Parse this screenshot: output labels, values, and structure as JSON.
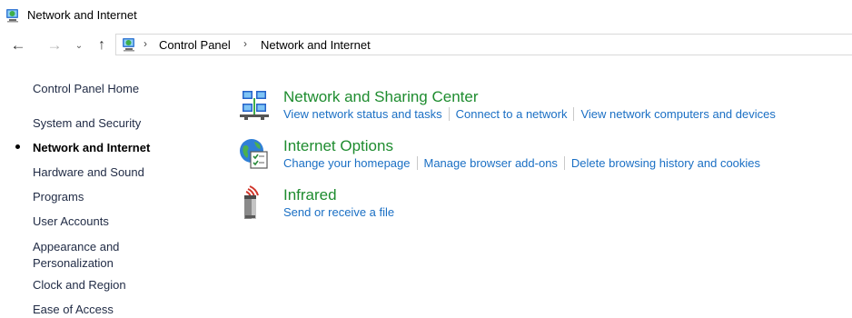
{
  "window": {
    "title": "Network and Internet",
    "icon": "network-globe-icon"
  },
  "navigation": {
    "back_icon": "←",
    "forward_icon": "→",
    "recent_icon": "⌄",
    "up_icon": "↑",
    "separator": "›",
    "breadcrumbs": [
      "Control Panel",
      "Network and Internet"
    ]
  },
  "sidebar": {
    "home": "Control Panel Home",
    "items": [
      "System and Security",
      "Network and Internet",
      "Hardware and Sound",
      "Programs",
      "User Accounts",
      "Appearance and\nPersonalization",
      "Clock and Region",
      "Ease of Access"
    ],
    "current_index": 1
  },
  "categories": [
    {
      "title": "Network and Sharing Center",
      "icon": "network-sharing-icon",
      "links": [
        "View network status and tasks",
        "Connect to a network",
        "View network computers and devices"
      ]
    },
    {
      "title": "Internet Options",
      "icon": "internet-options-icon",
      "links": [
        "Change your homepage",
        "Manage browser add-ons",
        "Delete browsing history and cookies"
      ]
    },
    {
      "title": "Infrared",
      "icon": "infrared-icon",
      "links": [
        "Send or receive a file"
      ]
    }
  ],
  "colors": {
    "category_title": "#1e8c2f",
    "link": "#1a6fc4",
    "sidebar_text": "#1f2a44"
  }
}
